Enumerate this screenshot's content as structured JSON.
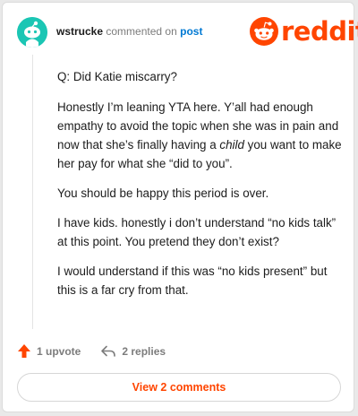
{
  "header": {
    "username": "wstrucke",
    "action_text": "commented on",
    "post_link": "post"
  },
  "logo": {
    "wordmark": "reddit",
    "icon": "reddit-snoo-icon"
  },
  "comment": {
    "paragraphs": [
      "Q: Did Katie miscarry?",
      "Honestly I’m leaning YTA here. Y’all had enough empathy to avoid the topic when she was in pain and now that she’s finally having a ",
      "You should be happy this period is over.",
      "I have kids. honestly i don’t understand “no kids talk” at this point. You pretend they don’t exist?",
      "I would understand if this was “no kids present” but this is a far cry from that."
    ],
    "p2_emph": "child",
    "p2_tail": " you want to make her pay for what she “did to you”."
  },
  "actions": {
    "upvote_label": "1 upvote",
    "replies_label": "2 replies"
  },
  "footer": {
    "view_comments_label": "View 2 comments"
  },
  "colors": {
    "brand": "#ff4500",
    "avatar": "#1bc6b4",
    "link": "#0079d3"
  }
}
